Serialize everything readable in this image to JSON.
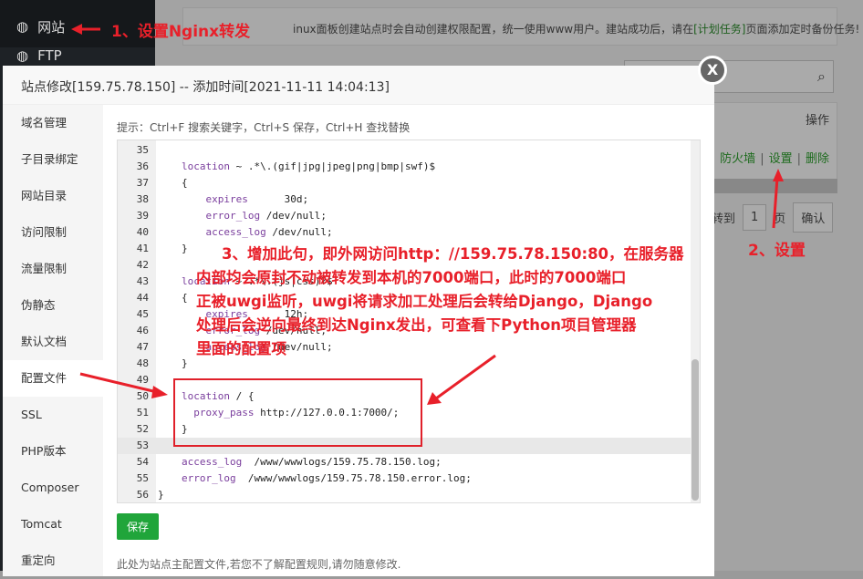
{
  "sidebar": {
    "items": [
      {
        "label": "网站",
        "icon": "globe-icon"
      },
      {
        "label": "FTP",
        "icon": "globe-icon"
      }
    ]
  },
  "background": {
    "notice_prefix": "inux面板创建站点时会自动创建权限配置，统一使用www用户。建站成功后，请在",
    "notice_link": "[计划任务]",
    "notice_suffix": "页面添加定时备份任务!",
    "table_header_ops": "操作",
    "ops": [
      "防火墙",
      "设置",
      "删除"
    ],
    "pager_goto": "转到",
    "pager_page": "1",
    "pager_unit": "页",
    "pager_confirm": "确认"
  },
  "modal": {
    "title": "站点修改[159.75.78.150] -- 添加时间[2021-11-11 14:04:13]",
    "close": "X",
    "menu": [
      "域名管理",
      "子目录绑定",
      "网站目录",
      "访问限制",
      "流量限制",
      "伪静态",
      "默认文档",
      "配置文件",
      "SSL",
      "PHP版本",
      "Composer",
      "Tomcat",
      "重定向"
    ],
    "active_menu": "配置文件",
    "tip": "提示：Ctrl+F 搜索关键字，Ctrl+S 保存，Ctrl+H 查找替换",
    "save": "保存",
    "footer": "此处为站点主配置文件,若您不了解配置规则,请勿随意修改."
  },
  "editor": {
    "lines": [
      {
        "n": "35",
        "code": ""
      },
      {
        "n": "36",
        "code": "location ~ .*\\.(gif|jpg|jpeg|png|bmp|swf)$"
      },
      {
        "n": "37",
        "code": "{"
      },
      {
        "n": "38",
        "code": "    expires      30d;"
      },
      {
        "n": "39",
        "code": "    error_log /dev/null;"
      },
      {
        "n": "40",
        "code": "    access_log /dev/null;"
      },
      {
        "n": "41",
        "code": "}"
      },
      {
        "n": "42",
        "code": ""
      },
      {
        "n": "43",
        "code": "location ~ .*\\.(js|css)?$"
      },
      {
        "n": "44",
        "code": "{"
      },
      {
        "n": "45",
        "code": "    expires      12h;"
      },
      {
        "n": "46",
        "code": "    error_log /dev/null;"
      },
      {
        "n": "47",
        "code": "    access_log /dev/null;"
      },
      {
        "n": "48",
        "code": "}"
      },
      {
        "n": "49",
        "code": ""
      },
      {
        "n": "50",
        "code": "location / {"
      },
      {
        "n": "51",
        "code": "  proxy_pass http://127.0.0.1:7000/;"
      },
      {
        "n": "52",
        "code": "}"
      },
      {
        "n": "53",
        "code": ""
      },
      {
        "n": "54",
        "code": "access_log  /www/wwwlogs/159.75.78.150.log;"
      },
      {
        "n": "55",
        "code": "error_log  /www/wwwlogs/159.75.78.150.error.log;"
      },
      {
        "n": "56",
        "code": "}"
      }
    ],
    "current_line": "53"
  },
  "annotations": {
    "a1": "1、设置Nginx转发",
    "a2": "2、设置",
    "a3": [
      "3、增加此句，即外网访问http：//159.75.78.150:80，在服务器",
      "内部均会原封不动被转发到本机的7000端口，此时的7000端口",
      "正被uwgi监听，uwgi将请求加工处理后会转给Django，Django",
      "处理后会逆向最终到达Nginx发出，可查看下Python项目管理器",
      "里面的配置项"
    ],
    "color": "#e8202a"
  }
}
